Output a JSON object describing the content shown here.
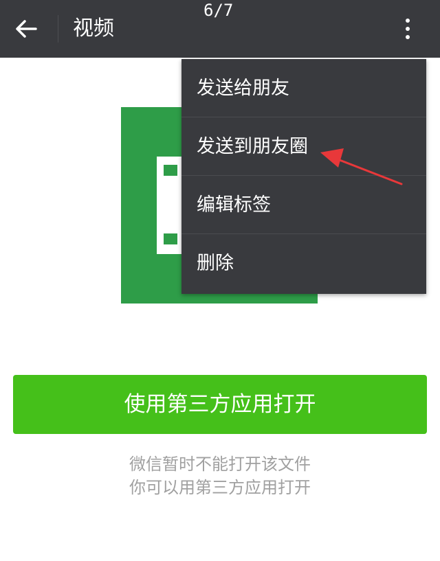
{
  "header": {
    "title": "视频",
    "page_counter": "6/7",
    "icons": {
      "back": "back-arrow-icon",
      "more": "more-vertical-icon"
    }
  },
  "menu": {
    "items": [
      {
        "label": "发送给朋友"
      },
      {
        "label": "发送到朋友圈"
      },
      {
        "label": "编辑标签"
      },
      {
        "label": "删除"
      }
    ]
  },
  "file_icon": {
    "name": "video-file-icon",
    "color": "#2e9d48"
  },
  "annotation": {
    "name": "red-arrow-annotation",
    "color": "#e8383a"
  },
  "main": {
    "open_button_label": "使用第三方应用打开",
    "hint_line1": "微信暂时不能打开该文件",
    "hint_line2": "你可以用第三方应用打开"
  },
  "colors": {
    "header_bg": "#393a3e",
    "menu_bg": "#393a3e",
    "accent_green": "#45c01a",
    "hint_text": "#a0a0a0"
  }
}
